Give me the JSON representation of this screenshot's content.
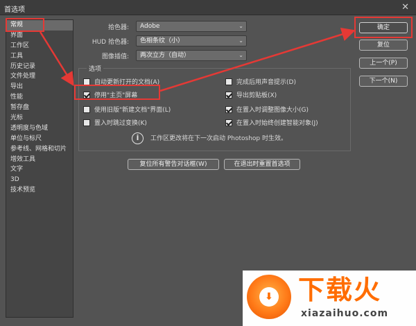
{
  "window": {
    "title": "首选项",
    "close_glyph": "✕"
  },
  "sidebar": {
    "items": [
      {
        "label": "常规",
        "active": true
      },
      {
        "label": "界面"
      },
      {
        "label": "工作区"
      },
      {
        "label": "工具"
      },
      {
        "label": "历史记录"
      },
      {
        "label": "文件处理"
      },
      {
        "label": "导出"
      },
      {
        "label": "性能"
      },
      {
        "label": "暂存盘"
      },
      {
        "label": "光标"
      },
      {
        "label": "透明度与色域"
      },
      {
        "label": "单位与标尺"
      },
      {
        "label": "参考线、网格和切片"
      },
      {
        "label": "增效工具"
      },
      {
        "label": "文字"
      },
      {
        "label": "3D"
      },
      {
        "label": "技术预览"
      }
    ]
  },
  "fields": {
    "color_picker": {
      "label": "拾色器:",
      "value": "Adobe"
    },
    "hud_picker": {
      "label": "HUD 拾色器:",
      "value": "色相条纹（小）"
    },
    "interpolation": {
      "label": "图像插值:",
      "value": "两次立方（自动）"
    }
  },
  "options": {
    "title": "选项",
    "left": [
      {
        "label": "自动更新打开的文档(A)",
        "checked": false
      },
      {
        "label": "停用\"主页\"屏幕",
        "checked": true
      },
      {
        "label": "使用旧版\"新建文档\"界面(L)",
        "checked": false
      },
      {
        "label": "置入时跳过变换(K)",
        "checked": false
      }
    ],
    "right": [
      {
        "label": "完成后用声音提示(D)",
        "checked": false
      },
      {
        "label": "导出剪贴板(X)",
        "checked": true
      },
      {
        "label": "在置入时调整图像大小(G)",
        "checked": true
      },
      {
        "label": "在置入时始终创建智能对象(J)",
        "checked": true
      }
    ],
    "info": "工作区更改将在下一次启动 Photoshop 时生效。"
  },
  "buttons": {
    "ok": "确定",
    "reset": "复位",
    "prev": "上一个(P)",
    "next": "下一个(N)",
    "reset_warnings": "复位所有警告对话框(W)",
    "reset_on_quit": "在退出时重置首选项"
  },
  "watermark": {
    "title": "下载火",
    "subtitle": "xiazaihuo.com"
  },
  "colors": {
    "highlight": "#e53935",
    "accent": "#ff6d00"
  }
}
